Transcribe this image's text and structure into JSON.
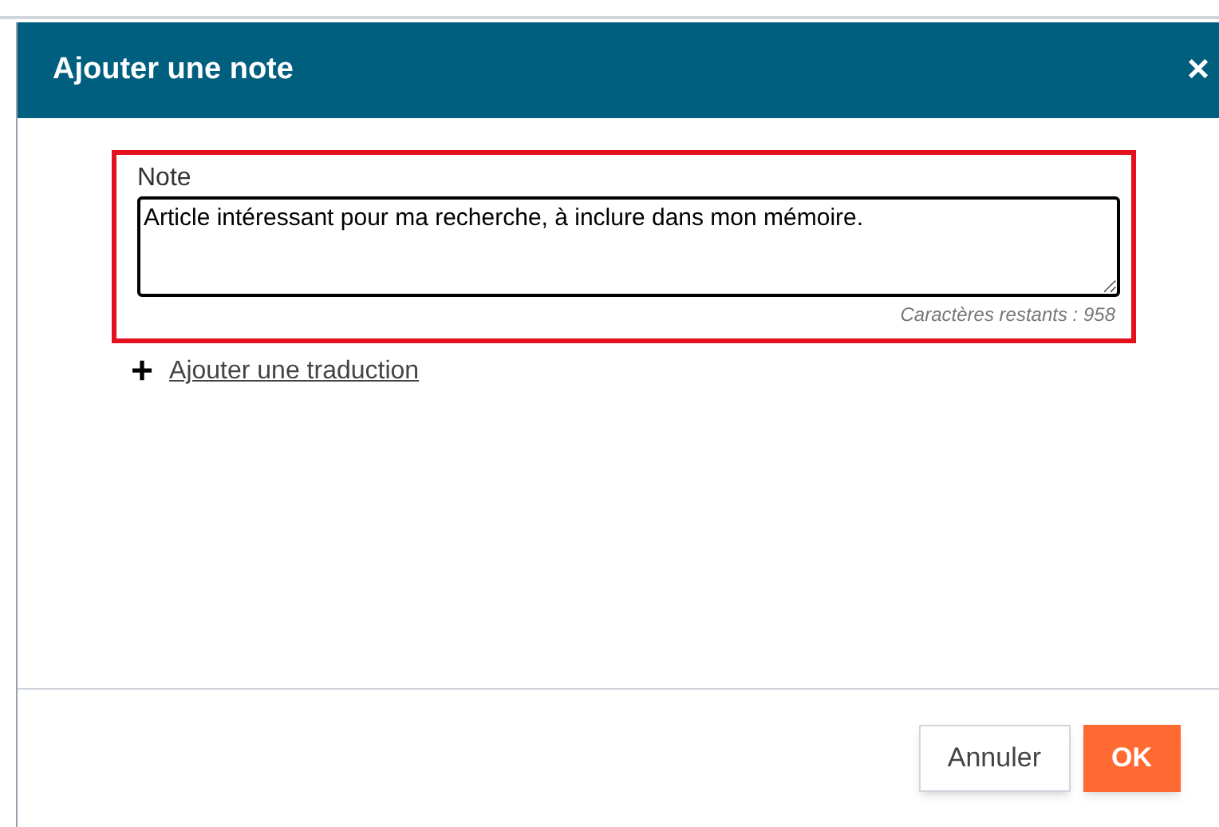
{
  "dialog": {
    "title": "Ajouter une note",
    "close": "×"
  },
  "note": {
    "label": "Note",
    "value": "Article intéressant pour ma recherche, à inclure dans mon mémoire.",
    "counter": "Caractères restants : 958",
    "highlighted": true
  },
  "add_translation": {
    "icon": "+",
    "label": "Ajouter une traduction"
  },
  "buttons": [
    {
      "label": "Annuler",
      "kind": "secondary"
    },
    {
      "label": "OK",
      "kind": "primary"
    }
  ]
}
